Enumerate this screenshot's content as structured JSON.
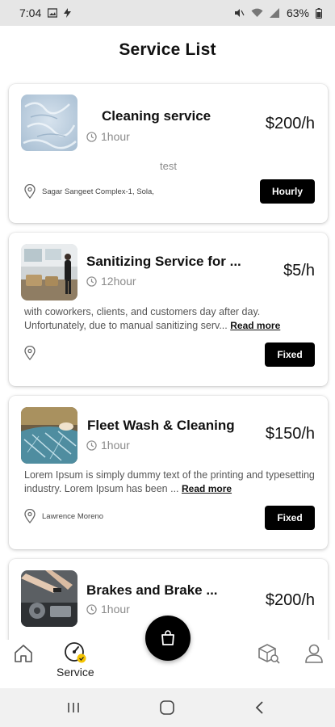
{
  "status_bar": {
    "time": "7:04",
    "battery": "63%",
    "left_icons": [
      "gallery-icon",
      "bolt-icon"
    ],
    "right_icons": [
      "mute-icon",
      "wifi-icon",
      "signal-icon",
      "battery-icon"
    ]
  },
  "header": {
    "title": "Service List"
  },
  "services": [
    {
      "title": "Cleaning service",
      "duration": "1hour",
      "price": "$200/h",
      "note": "test",
      "location": "Sagar Sangeet Complex-1, Sola,",
      "badge": "Hourly",
      "image": "frosted-glass-image"
    },
    {
      "title": "Sanitizing Service for ...",
      "duration": "12hour",
      "price": "$5/h",
      "description": "with coworkers, clients, and customers day after day. Unfortunately, due to manual sanitizing serv...",
      "read_more": "Read more",
      "location": "",
      "badge": "Fixed",
      "image": "office-sanitizing-image"
    },
    {
      "title": "Fleet Wash & Cleaning",
      "duration": "1hour",
      "price": "$150/h",
      "description": "Lorem Ipsum is simply dummy text of the printing and typesetting industry. Lorem Ipsum has been ...",
      "read_more": "Read more",
      "location": "Lawrence Moreno",
      "badge": "Fixed",
      "image": "car-wash-image"
    },
    {
      "title": "Brakes and Brake ...",
      "duration": "1hour",
      "price": "$200/h",
      "image": "car-engine-image"
    }
  ],
  "bottom_nav": {
    "items": [
      {
        "icon": "home-icon",
        "label": ""
      },
      {
        "icon": "service-gauge-icon",
        "label": "Service",
        "active": true
      },
      {
        "icon": "package-search-icon",
        "label": ""
      },
      {
        "icon": "profile-icon",
        "label": ""
      }
    ],
    "fab_icon": "shopping-bag-icon"
  },
  "system_nav": {
    "icons": [
      "recents-icon",
      "home-circle-icon",
      "back-icon"
    ]
  },
  "colors": {
    "accent": "#000000",
    "badge_text": "#ffffff",
    "muted": "#8a8a8a",
    "active_dot": "#f5c400"
  }
}
